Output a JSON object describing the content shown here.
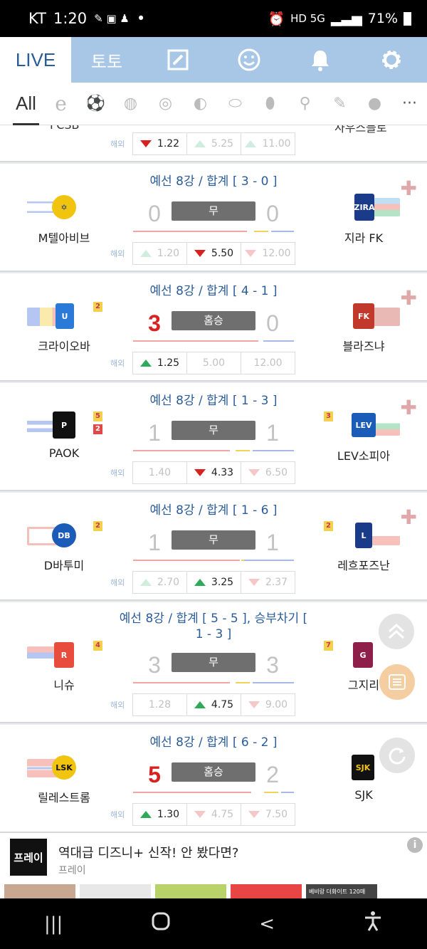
{
  "status": {
    "carrier": "KT",
    "time": "1:20",
    "dot": "•",
    "net": "HD 5G",
    "battery": "71%"
  },
  "topnav": {
    "live": "LIVE",
    "toto": "토토",
    "icons": [
      "edit-icon",
      "smiley-icon",
      "bell-icon",
      "gear-icon"
    ]
  },
  "sports": {
    "all": "All",
    "icons": [
      "esports-icon",
      "soccer-icon",
      "baseball-icon",
      "basketball-icon",
      "volleyball-icon",
      "hockey-icon",
      "football-icon",
      "tennis-icon",
      "badminton-icon",
      "profile-icon"
    ],
    "more": "···"
  },
  "partial": {
    "home_name": "FCSB",
    "away_name": "사우스블로",
    "abroad": "해외",
    "odds": [
      "1.22",
      "5.25",
      "11.00"
    ]
  },
  "matches": [
    {
      "round": "예선 8강 / 합계 [ 3 - 0 ]",
      "home": "M텔아비브",
      "away": "지라 FK",
      "home_score": "0",
      "away_score": "0",
      "result": "무",
      "home_cards_y": "",
      "home_cards_r": "",
      "away_cards_y": "",
      "away_cards_r": "",
      "abroad": "해외",
      "odds": [
        "1.20",
        "5.50",
        "12.00"
      ]
    },
    {
      "round": "예선 8강 / 합계 [ 4 - 1 ]",
      "home": "크라이오바",
      "away": "블라즈냐",
      "home_score": "3",
      "away_score": "0",
      "result": "홈승",
      "home_cards_y": "2",
      "home_cards_r": "",
      "away_cards_y": "",
      "away_cards_r": "",
      "abroad": "해외",
      "odds": [
        "1.25",
        "5.00",
        "12.00"
      ]
    },
    {
      "round": "예선 8강 / 합계 [ 1 - 3 ]",
      "home": "PAOK",
      "away": "LEV소피아",
      "home_score": "1",
      "away_score": "1",
      "result": "무",
      "home_cards_y": "5",
      "home_cards_r": "2",
      "away_cards_y": "3",
      "away_cards_r": "",
      "abroad": "해외",
      "odds": [
        "1.40",
        "4.33",
        "6.50"
      ]
    },
    {
      "round": "예선 8강 / 합계 [ 1 - 6 ]",
      "home": "D바투미",
      "away": "레흐포즈난",
      "home_score": "1",
      "away_score": "1",
      "result": "무",
      "home_cards_y": "2",
      "home_cards_r": "",
      "away_cards_y": "2",
      "away_cards_r": "",
      "abroad": "해외",
      "odds": [
        "2.70",
        "3.25",
        "2.37"
      ]
    },
    {
      "round": "예선 8강 / 합계 [ 5 - 5 ], 승부차기 [ 1 - 3 ]",
      "home": "니슈",
      "away": "그지리",
      "home_score": "3",
      "away_score": "3",
      "result": "무",
      "home_cards_y": "4",
      "home_cards_r": "",
      "away_cards_y": "7",
      "away_cards_r": "",
      "abroad": "해외",
      "odds": [
        "1.28",
        "4.75",
        "9.00"
      ]
    },
    {
      "round": "예선 8강 / 합계 [ 6 - 2 ]",
      "home": "릴레스트롬",
      "away": "SJK",
      "home_score": "5",
      "away_score": "2",
      "result": "홈승",
      "home_cards_y": "",
      "home_cards_r": "",
      "away_cards_y": "",
      "away_cards_r": "",
      "abroad": "해외",
      "odds": [
        "1.30",
        "4.75",
        "7.50"
      ]
    }
  ],
  "ad": {
    "thumb_text": "프레이",
    "title": "역대급 디즈니+ 신작! 안 봤다면?",
    "source": "프레이",
    "info": "i",
    "strip_text": "베비랑 더화이트 120매"
  },
  "navbar": {
    "recents": "|||",
    "home": "○",
    "back": "<",
    "accessibility": "accessibility-icon"
  }
}
